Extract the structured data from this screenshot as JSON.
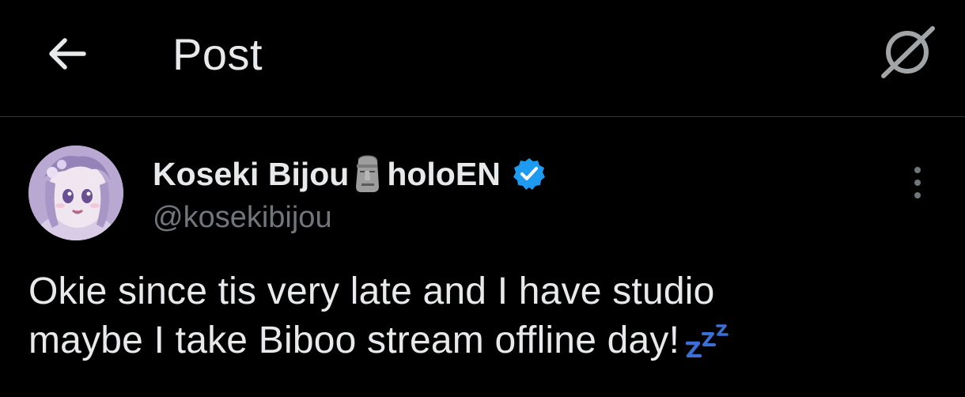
{
  "header": {
    "title": "Post",
    "back_icon": "arrow-left-icon",
    "grok_icon": "grok-icon"
  },
  "post": {
    "author": {
      "name": "Koseki Bijou",
      "name_suffix": "holoEN",
      "name_emoji": "moai",
      "handle": "@kosekibijou",
      "verified": true,
      "verified_color": "#1d9bf0"
    },
    "text_line1": "Okie since tis very late and I have studio",
    "text_line2": "maybe I take Biboo stream offline day!",
    "text_emoji": "zzz",
    "more_icon": "more-vertical-icon"
  },
  "colors": {
    "background": "#000000",
    "text": "#e7e9ea",
    "secondary_text": "#71767b",
    "divider": "#2f3336",
    "accent": "#1d9bf0"
  }
}
